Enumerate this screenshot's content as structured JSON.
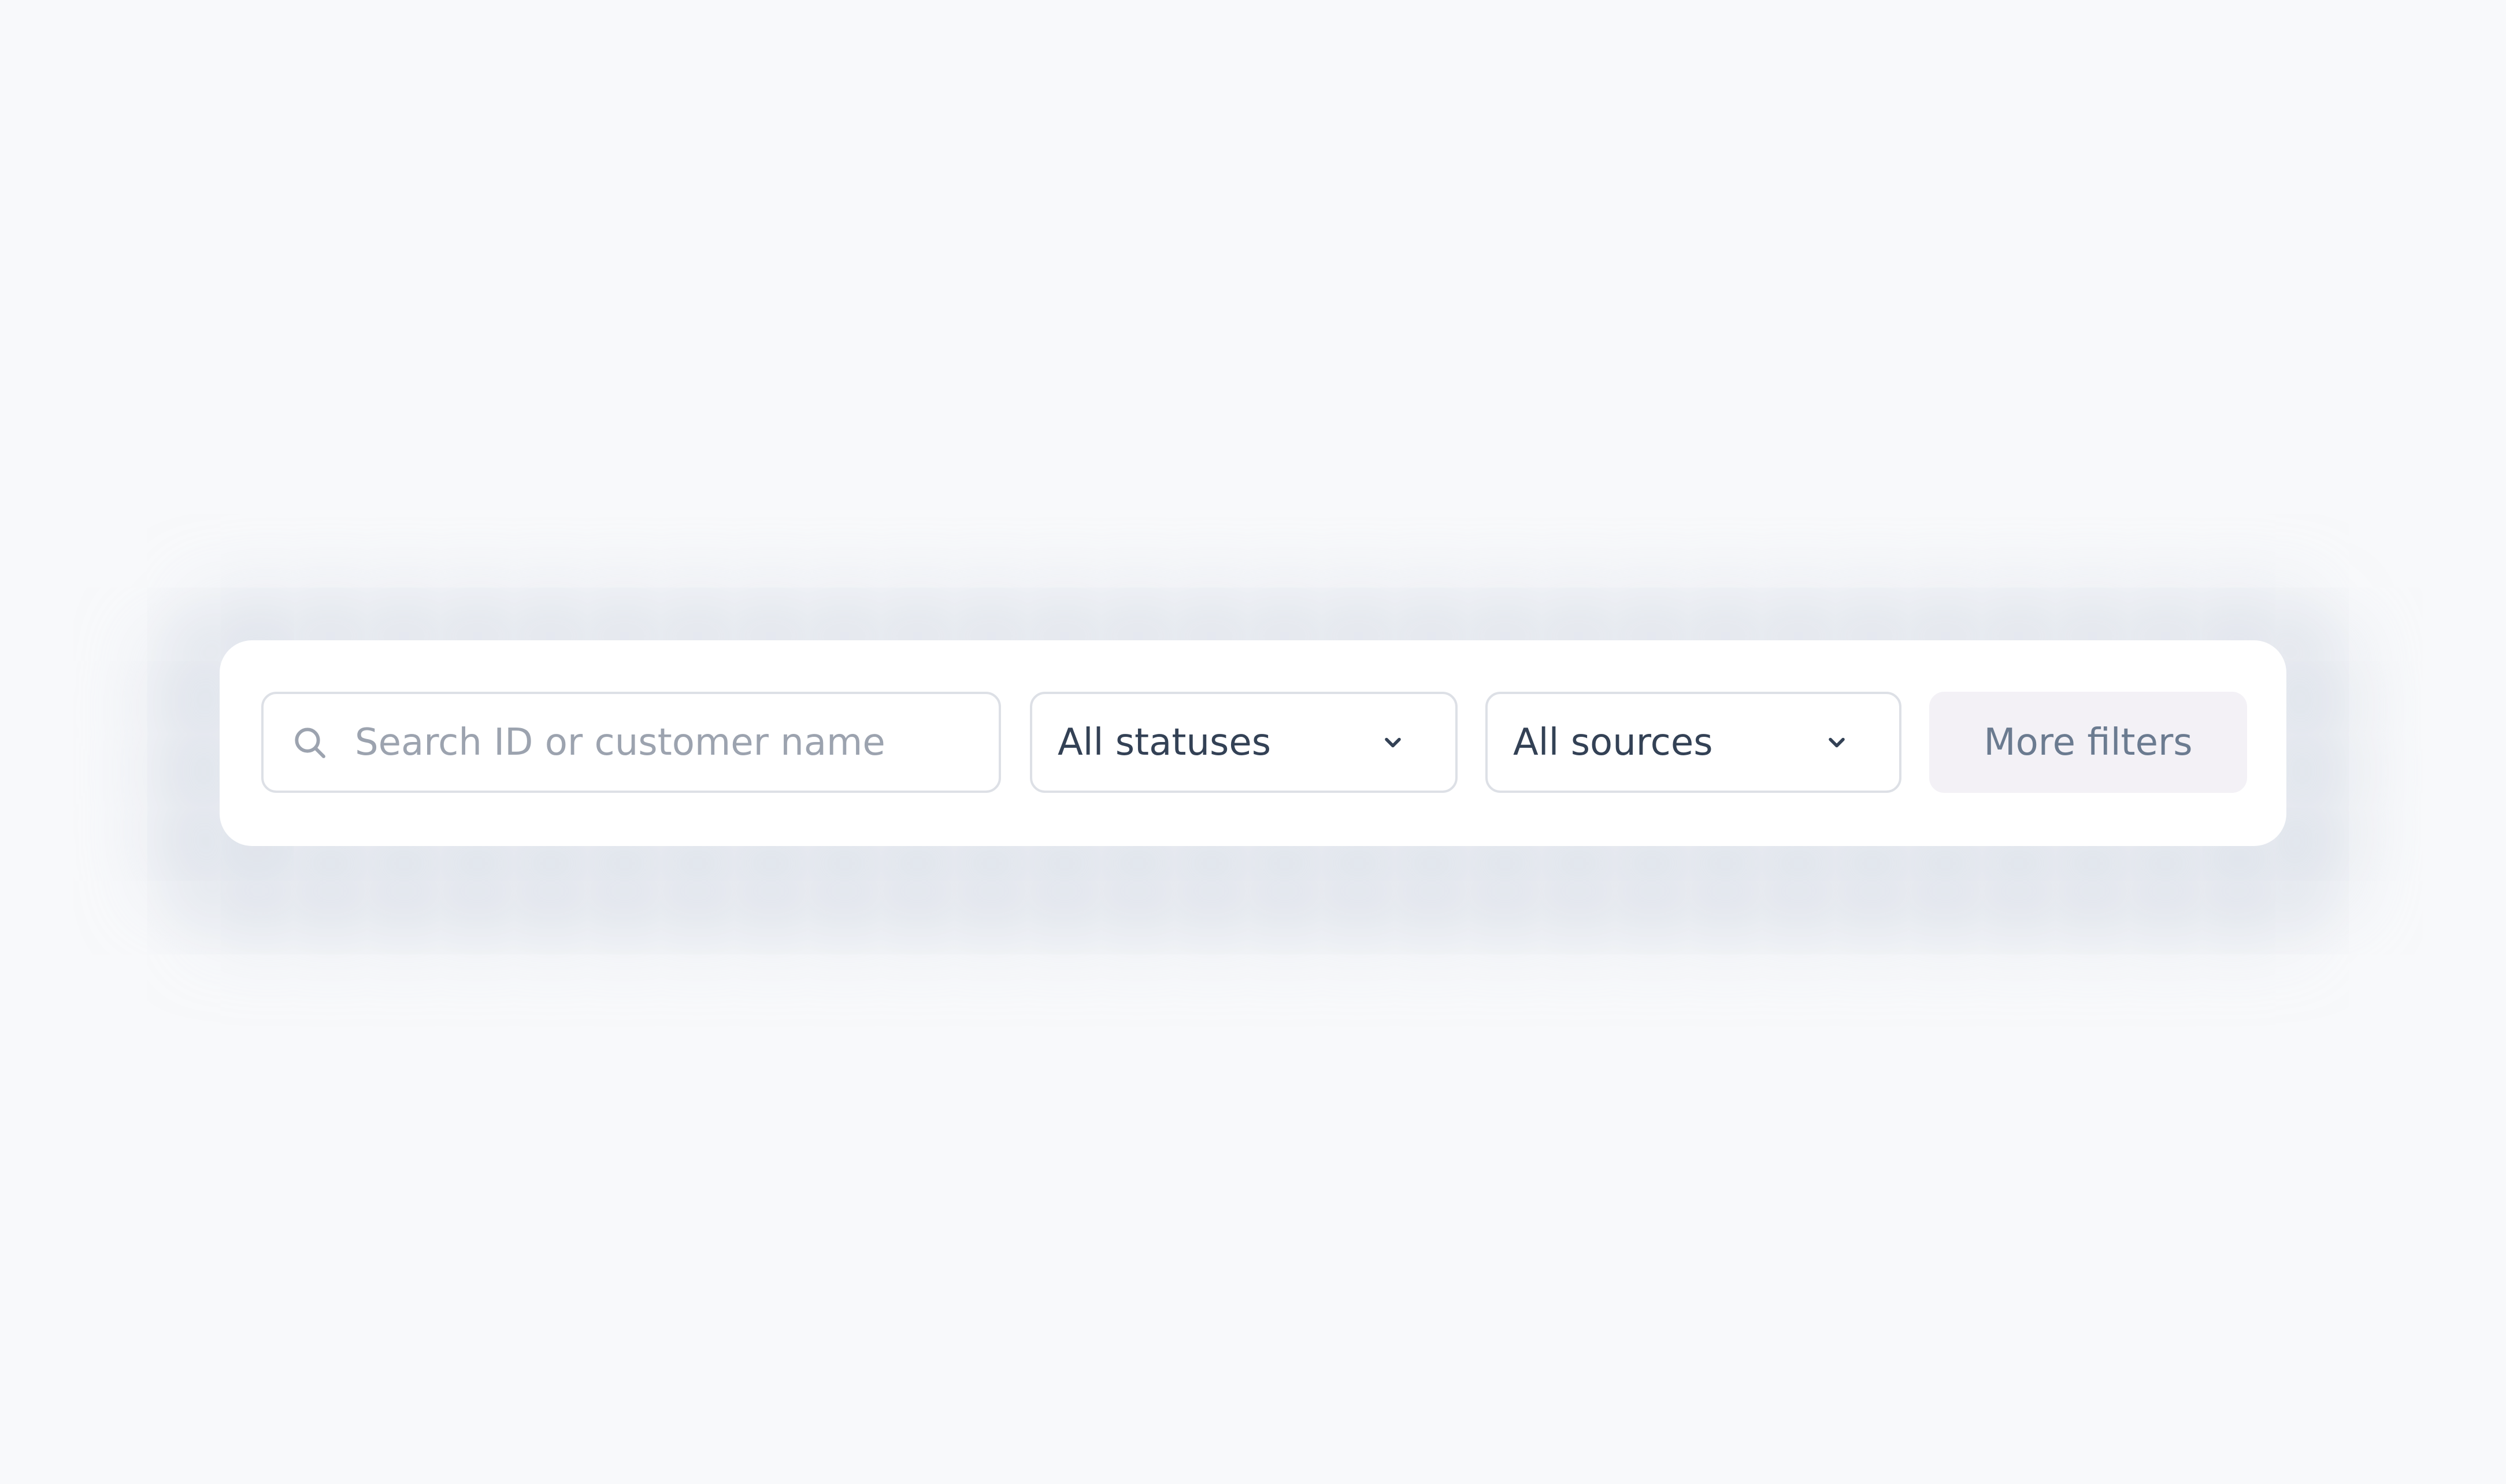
{
  "filters": {
    "search": {
      "placeholder": "Search ID or customer name",
      "icon": "search-icon"
    },
    "status_select": {
      "selected": "All statuses",
      "icon": "chevron-down-icon"
    },
    "source_select": {
      "selected": "All sources",
      "icon": "chevron-down-icon"
    },
    "more_filters_label": "More filters"
  },
  "colors": {
    "background": "#f8f9fb",
    "card": "#ffffff",
    "border": "#dde0e6",
    "placeholder_text": "#9ca3af",
    "select_text": "#334155",
    "button_bg": "#f3f1f6",
    "button_text": "#6b7b90"
  }
}
